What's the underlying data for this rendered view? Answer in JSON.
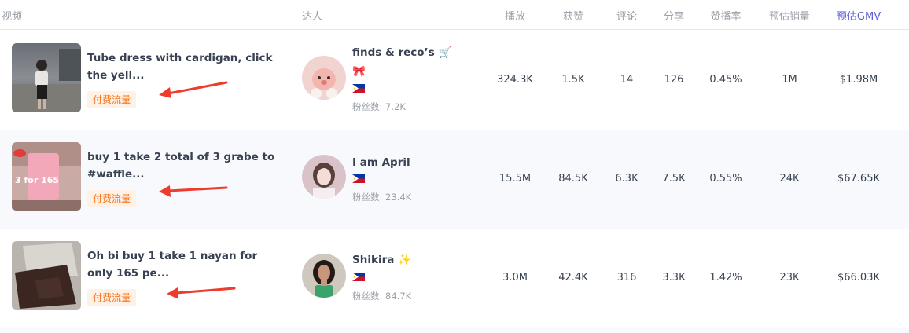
{
  "columns": {
    "video": "视频",
    "creator": "达人",
    "plays": "播放",
    "likes": "获赞",
    "comments": "评论",
    "shares": "分享",
    "like_rate": "赞播率",
    "est_sales": "预估销量",
    "est_gmv": "预估GMV"
  },
  "accent_color": "#5b5bd6",
  "tag_color": "#f97316",
  "rows": [
    {
      "video_title": "Tube dress with cardigan, click the yell...",
      "tag": "付费流量",
      "creator_name": "finds & reco’s 🛒",
      "creator_emoji": "🎀",
      "flag": "philippines-flag-icon",
      "followers": "粉丝数: 7.2K",
      "plays": "324.3K",
      "likes": "1.5K",
      "comments": "14",
      "shares": "126",
      "like_rate": "0.45%",
      "est_sales": "1M",
      "est_gmv": "$1.98M"
    },
    {
      "video_title": "buy 1 take 2 total of 3 grabe to #waffle...",
      "tag": "付费流量",
      "creator_name": "I am April",
      "flag": "philippines-flag-icon",
      "followers": "粉丝数: 23.4K",
      "plays": "15.5M",
      "likes": "84.5K",
      "comments": "6.3K",
      "shares": "7.5K",
      "like_rate": "0.55%",
      "est_sales": "24K",
      "est_gmv": "$67.65K"
    },
    {
      "video_title": "Oh bi buy 1 take 1 nayan for only 165 pe...",
      "tag": "付费流量",
      "creator_name": "Shikira ✨",
      "flag": "philippines-flag-icon",
      "followers": "粉丝数: 84.7K",
      "plays": "3.0M",
      "likes": "42.4K",
      "comments": "316",
      "shares": "3.3K",
      "like_rate": "1.42%",
      "est_sales": "23K",
      "est_gmv": "$66.03K"
    }
  ]
}
